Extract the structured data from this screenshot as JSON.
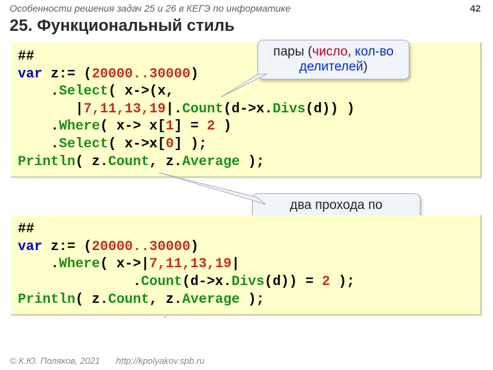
{
  "header": {
    "subtitle": "Особенности решения задач 25 и 26 в КЕГЭ по информатике",
    "page": "42"
  },
  "title": "25. Функциональный стиль",
  "code1": {
    "l1": "##",
    "l2a": "var",
    "l2b": " z:= (",
    "l2c": "20000..30000",
    "l2d": ")",
    "l3a": "    .",
    "l3b": "Select",
    "l3c": "( x->(x,",
    "l4a": "       |",
    "l4b": "7,11,13,19",
    "l4c": "|.",
    "l4d": "Count",
    "l4e": "(d->x.",
    "l4f": "Divs",
    "l4g": "(d)) )",
    "l5a": "    .",
    "l5b": "Where",
    "l5c": "( x-> x[",
    "l5d": "1",
    "l5e": "] = ",
    "l5f": "2",
    "l5g": " )",
    "l6a": "    .",
    "l6b": "Select",
    "l6c": "( x->x[",
    "l6d": "0",
    "l6e": "] );",
    "l7a": "Println",
    "l7b": "( z.",
    "l7c": "Count",
    "l7d": ", z.",
    "l7e": "Average",
    "l7f": " );"
  },
  "callout1": {
    "pre": "пары (",
    "a": "число",
    "sep": ", ",
    "b": "кол-во делителей",
    "post": ")"
  },
  "callout2": {
    "text": "два прохода по последовательности"
  },
  "code2": {
    "l1": "##",
    "l2a": "var",
    "l2b": " z:= (",
    "l2c": "20000..30000",
    "l2d": ")",
    "l3a": "    .",
    "l3b": "Where",
    "l3c": "( x->|",
    "l3d": "7,11,13,19",
    "l3e": "|",
    "l4a": "              .",
    "l4b": "Count",
    "l4c": "(d->x.",
    "l4d": "Divs",
    "l4e": "(d)) = ",
    "l4f": "2",
    "l4g": " );",
    "l5a": "Println",
    "l5b": "( z.",
    "l5c": "Count",
    "l5d": ", z.",
    "l5e": "Average",
    "l5f": " );"
  },
  "footer": {
    "copy": "© К.Ю. Поляков, 2021",
    "url": "http://kpolyakov.spb.ru"
  }
}
